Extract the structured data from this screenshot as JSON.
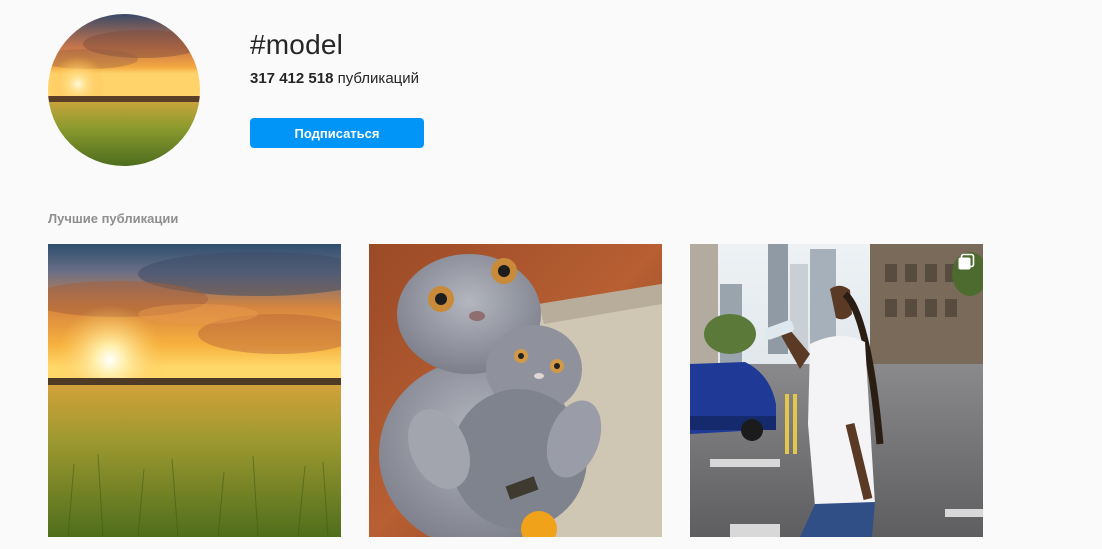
{
  "header": {
    "hashtag": "#model",
    "post_count_number": "317 412 518",
    "post_count_label": " публикаций",
    "follow_button_label": "Подписаться"
  },
  "top_posts": {
    "section_title": "Лучшие публикации",
    "posts": [
      {
        "subject": "sunset over grass field",
        "multiple": false
      },
      {
        "subject": "grey cat hugging plush cat toy",
        "multiple": false
      },
      {
        "subject": "man drinking water on city street",
        "multiple": true
      }
    ]
  },
  "colors": {
    "accent": "#0095f6",
    "background": "#fafafa",
    "text_primary": "#262626",
    "text_secondary": "#8e8e8e"
  },
  "icons": {
    "multiple_posts": "carousel-icon"
  }
}
